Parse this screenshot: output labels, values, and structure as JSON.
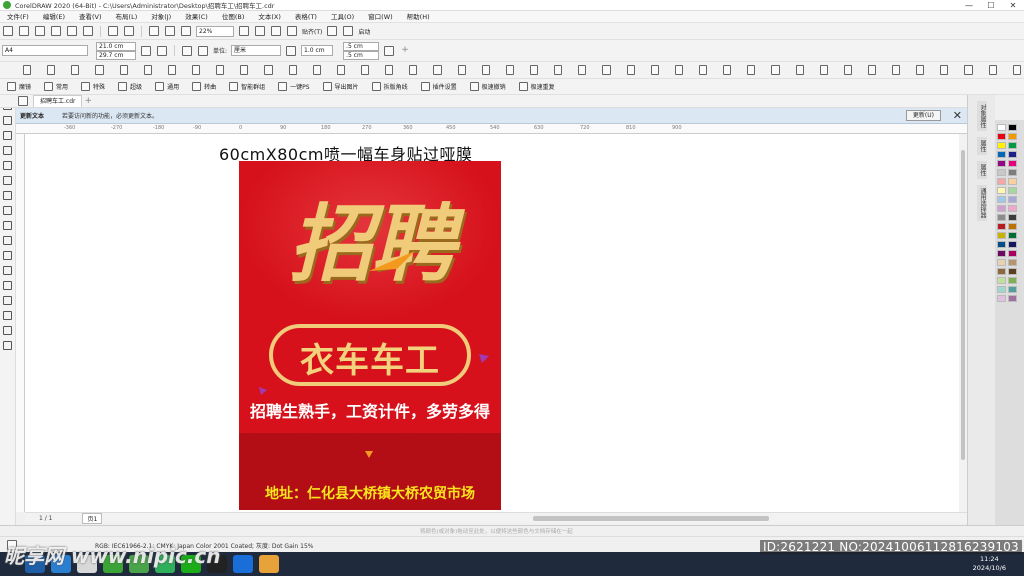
{
  "window": {
    "title": "CorelDRAW 2020 (64-Bit) - C:\\Users\\Administrator\\Desktop\\招聘车工\\招聘车工.cdr",
    "controls": [
      "—",
      "☐",
      "✕"
    ]
  },
  "menu": [
    "文件(F)",
    "编辑(E)",
    "查看(V)",
    "布局(L)",
    "对象(J)",
    "效果(C)",
    "位图(B)",
    "文本(X)",
    "表格(T)",
    "工具(O)",
    "窗口(W)",
    "帮助(H)"
  ],
  "toolbar1": {
    "zoom": "22%",
    "snap_label": "贴齐(T)",
    "launch_label": "启动"
  },
  "toolbar2": {
    "page_size": "A4",
    "width": "21.0 cm",
    "height": "29.7 cm",
    "units_label": "单位:",
    "units": "厘米",
    "nudge": "1.0 cm",
    "dup_x": ".5 cm",
    "dup_y": ".5 cm"
  },
  "plugins": {
    "row": [
      "魔镜",
      "常用",
      "特殊",
      "超级",
      "通用",
      "转曲",
      "智能群组",
      "一键PS",
      "导出图片",
      "拆版角线",
      "插件设置",
      "极速撤销",
      "极速重复"
    ]
  },
  "document_tab": "招聘车工.cdr",
  "infobar": {
    "title": "更新文本",
    "message": "若要访问新的功能，必须更新文本。",
    "update_button": "更新(U)",
    "close": "✕"
  },
  "ruler_ticks": [
    "-360",
    "-270",
    "-180",
    "-90",
    "0",
    "90",
    "180",
    "270",
    "360",
    "450",
    "540",
    "630",
    "720",
    "810",
    "900"
  ],
  "canvas": {
    "heading": "60cmX80cm喷一幅车身贴过哑膜"
  },
  "poster": {
    "headline": "招聘",
    "job_title": "衣车车工",
    "subtitle": "招聘生熟手，工资计件，多劳多得",
    "address": "地址：仁化县大桥镇大桥农贸市场",
    "colors": {
      "background": "#d6111b",
      "gold": "#f0cb7a",
      "address_yellow": "#f8e51c",
      "accent_orange": "#f39a1e"
    }
  },
  "page_nav": {
    "position": "1 / 1",
    "page_tab": "页1"
  },
  "docker_tabs": [
    "对象属性",
    "属性",
    "属性",
    "通用选择器"
  ],
  "status": {
    "hint": "将颜色(或对象)拖动至此处，以便将这些颜色与文档存储在一起",
    "color_profile": "RGB: IEC61966-2.1; CMYK: Japan Color 2001 Coated; 灰度: Dot Gain 15%"
  },
  "taskbar": {
    "time": "11:24",
    "date": "2024/10/6"
  },
  "watermark": {
    "left": "昵享网 www.nipic.cn",
    "right": "ID:2621221 NO:20241006112816239103"
  }
}
